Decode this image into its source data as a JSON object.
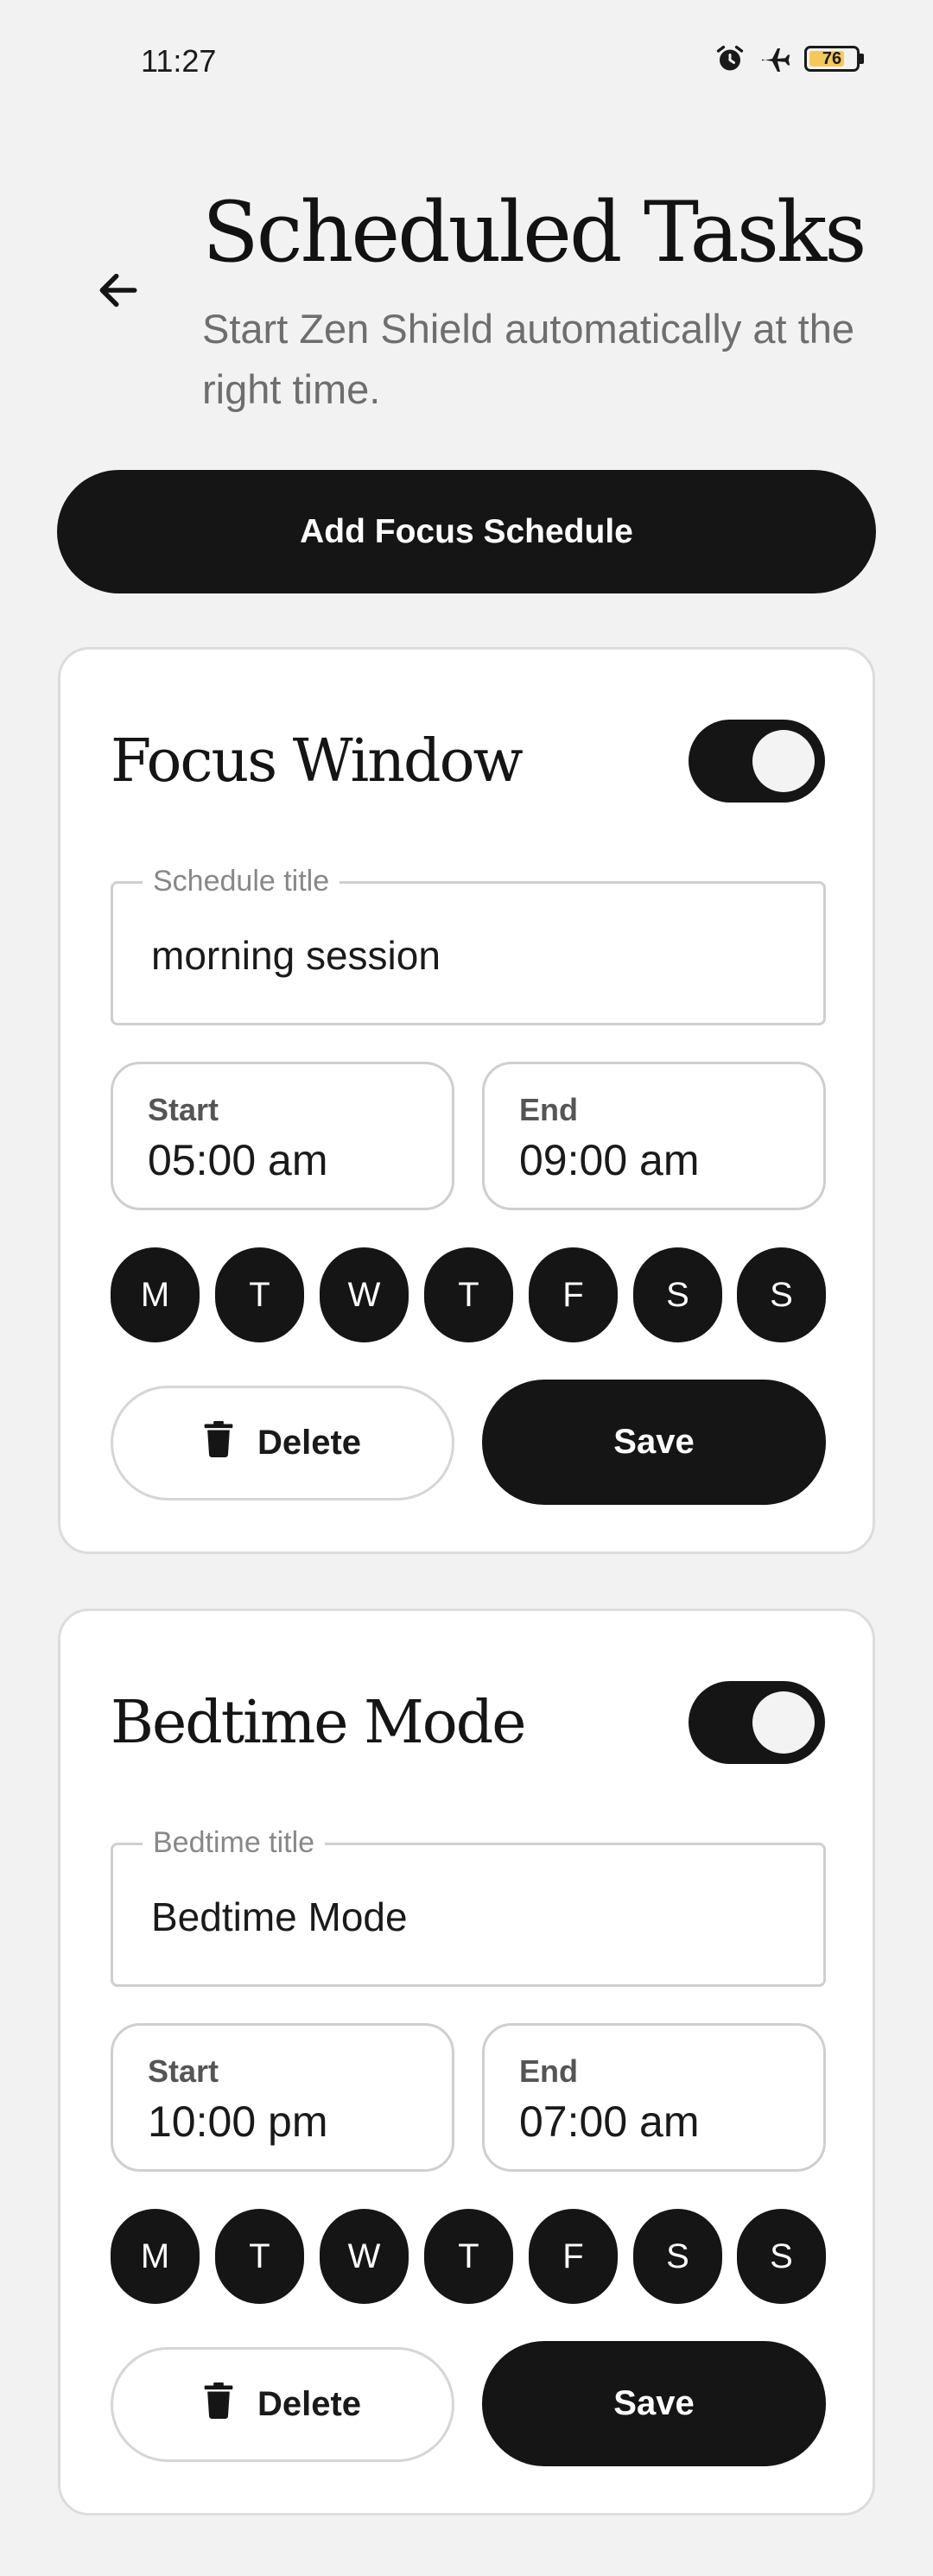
{
  "status_bar": {
    "time": "11:27",
    "battery_level": "76",
    "battery_fraction": 0.76,
    "icons": [
      "alarm-icon",
      "airplane-icon",
      "battery-icon"
    ]
  },
  "header": {
    "back_icon": "arrow-left-icon",
    "title": "Scheduled Tasks",
    "subtitle": "Start Zen Shield automatically at the right time."
  },
  "add_button_label": "Add Focus Schedule",
  "schedules": [
    {
      "name": "Focus Window",
      "enabled": true,
      "field_label": "Schedule title",
      "field_value": "morning session",
      "start_label": "Start",
      "start_time": "05:00 am",
      "end_label": "End",
      "end_time": "09:00 am",
      "days": [
        "M",
        "T",
        "W",
        "T",
        "F",
        "S",
        "S"
      ],
      "delete_label": "Delete",
      "save_label": "Save"
    },
    {
      "name": "Bedtime Mode",
      "enabled": true,
      "field_label": "Bedtime title",
      "field_value": "Bedtime Mode",
      "start_label": "Start",
      "start_time": "10:00 pm",
      "end_label": "End",
      "end_time": "07:00 am",
      "days": [
        "M",
        "T",
        "W",
        "T",
        "F",
        "S",
        "S"
      ],
      "delete_label": "Delete",
      "save_label": "Save"
    }
  ],
  "colors": {
    "background": "#f2f2f2",
    "primary": "#151515",
    "card": "#ffffff",
    "battery": "#f4c95a"
  }
}
